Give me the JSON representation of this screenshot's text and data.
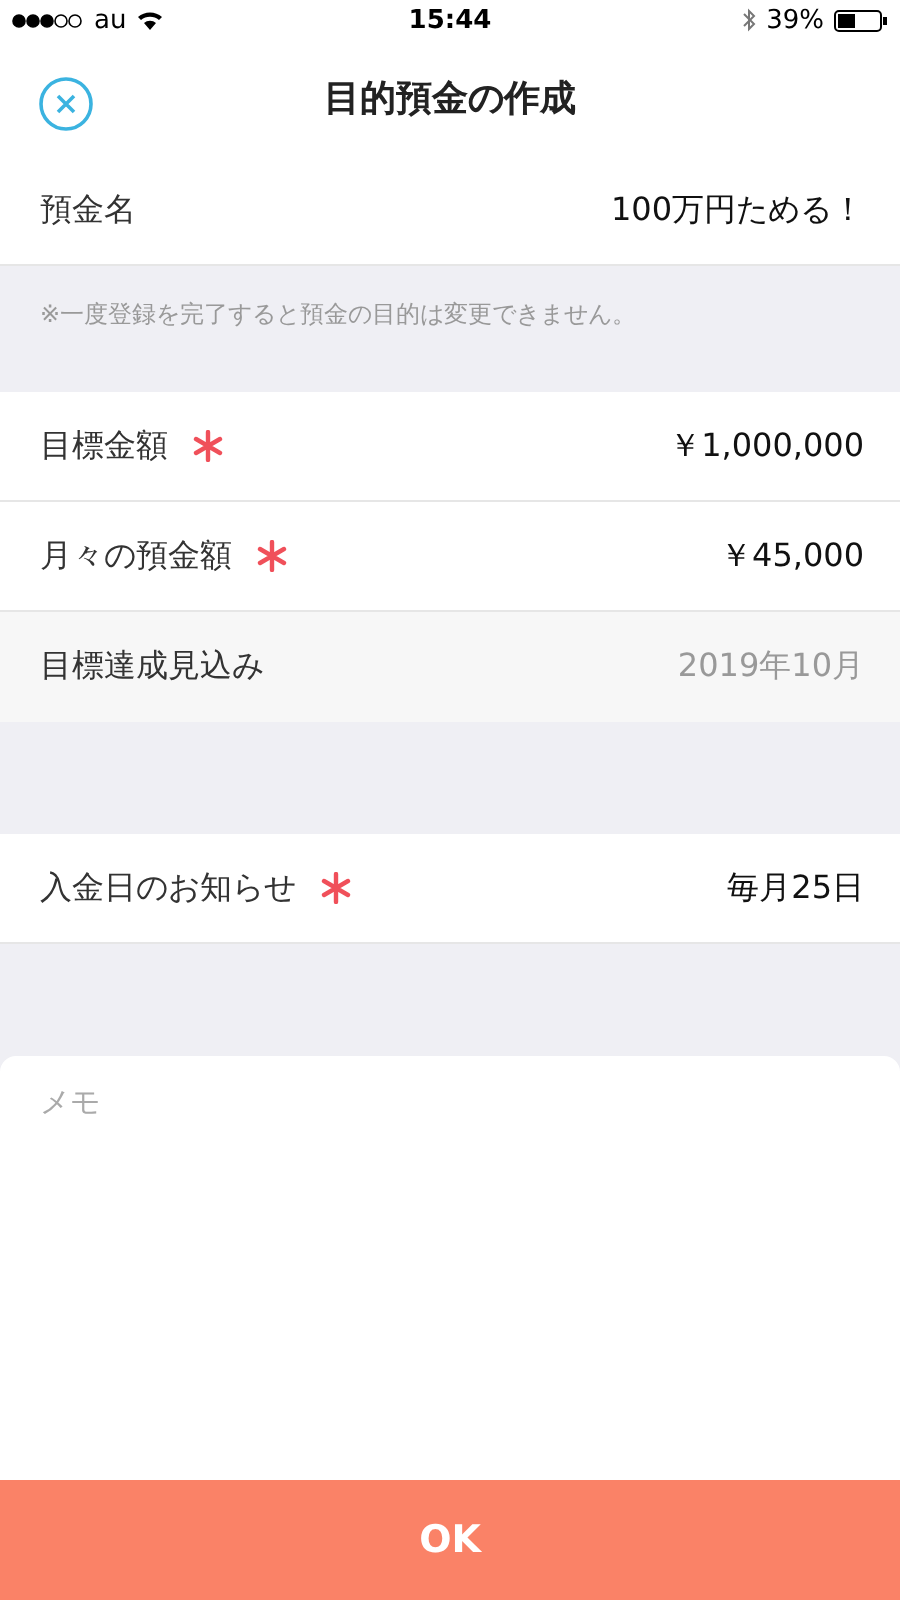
{
  "status_bar": {
    "carrier": "au",
    "time": "15:44",
    "battery": "39%"
  },
  "header": {
    "title": "目的預金の作成"
  },
  "name_row": {
    "label": "預金名",
    "value": "100万円ためる！"
  },
  "note": "※一度登録を完了すると預金の目的は変更できません。",
  "sections": [
    {
      "rows": [
        {
          "kind": "input",
          "label": "目標金額",
          "value": "￥1,000,000",
          "required": true
        },
        {
          "kind": "input",
          "label": "月々の預金額",
          "value": "￥45,000",
          "required": true
        },
        {
          "kind": "computed",
          "label": "目標達成見込み",
          "value": "2019年10月",
          "required": false
        }
      ]
    },
    {
      "rows": [
        {
          "kind": "input",
          "label": "入金日のお知らせ",
          "value": "毎月25日",
          "required": true
        }
      ]
    }
  ],
  "memo": {
    "placeholder": "メモ"
  },
  "ok_button": {
    "label": "OK"
  }
}
